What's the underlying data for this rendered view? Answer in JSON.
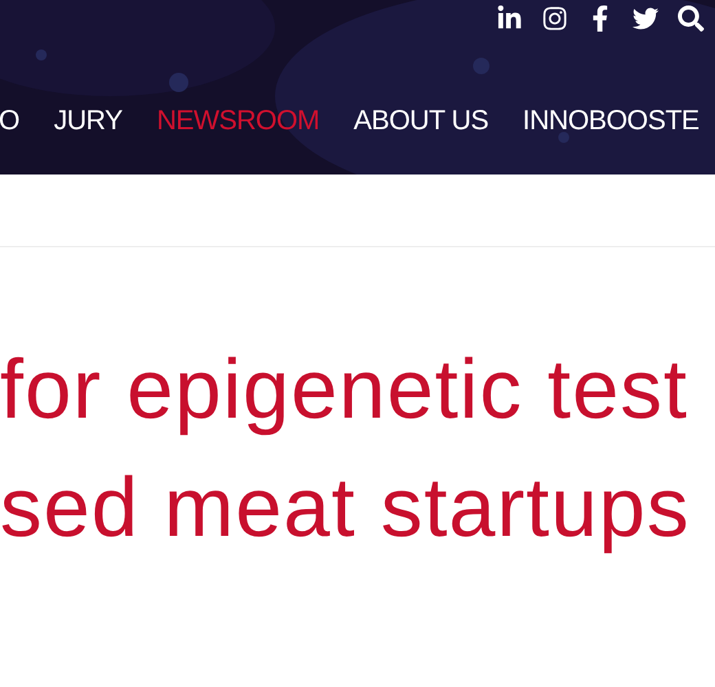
{
  "header": {
    "social_links": [
      {
        "kind": "linkedin"
      },
      {
        "kind": "instagram"
      },
      {
        "kind": "facebook"
      },
      {
        "kind": "twitter"
      },
      {
        "kind": "search"
      }
    ],
    "nav": [
      {
        "label": "O",
        "selected": false
      },
      {
        "label": "JURY",
        "selected": false
      },
      {
        "label": "NEWSROOM",
        "selected": true
      },
      {
        "label": "ABOUT US",
        "selected": false
      },
      {
        "label": "INNOBOOSTE",
        "selected": false
      }
    ]
  },
  "article": {
    "title_lines": [
      "for epigenetic test",
      "sed meat startups"
    ]
  }
}
